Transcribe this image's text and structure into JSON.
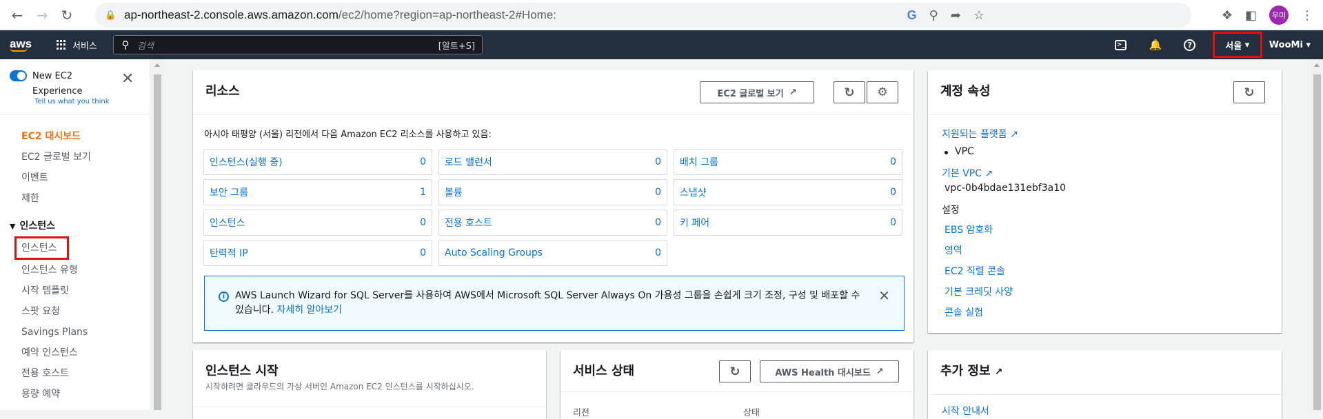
{
  "browser": {
    "url_host": "ap-northeast-2.console.aws.amazon.com",
    "url_path": "/ec2/home?region=ap-northeast-2#Home:",
    "avatar_text": "우미"
  },
  "aws_nav": {
    "logo": "aws",
    "services_label": "서비스",
    "search_placeholder": "검색",
    "search_shortcut": "[알트+S]",
    "region_label": "서울",
    "user_label": "WooMi"
  },
  "sidebar": {
    "toggle_label": "New EC2 Experience",
    "tell_us": "Tell us what you think",
    "top_items": [
      {
        "label": "EC2 대시보드",
        "active": true
      },
      {
        "label": "EC2 글로벌 보기"
      },
      {
        "label": "이벤트"
      },
      {
        "label": "제한"
      }
    ],
    "section_label": "인스턴스",
    "section_items": [
      {
        "label": "인스턴스",
        "highlighted": true
      },
      {
        "label": "인스턴스 유형"
      },
      {
        "label": "시작 템플릿"
      },
      {
        "label": "스팟 요청"
      },
      {
        "label": "Savings Plans"
      },
      {
        "label": "예약 인스턴스"
      },
      {
        "label": "전용 호스트"
      },
      {
        "label": "용량 예약"
      }
    ]
  },
  "resources": {
    "title": "리소스",
    "global_view_button": "EC2 글로벌 보기",
    "intro": "아시아 태평양 (서울) 리전에서 다음 Amazon EC2 리소스를 사용하고 있음:",
    "cells": [
      {
        "label": "인스턴스(실행 중)",
        "count": "0"
      },
      {
        "label": "로드 밸런서",
        "count": "0"
      },
      {
        "label": "배치 그룹",
        "count": "0"
      },
      {
        "label": "보안 그룹",
        "count": "1"
      },
      {
        "label": "볼륨",
        "count": "0"
      },
      {
        "label": "스냅샷",
        "count": "0"
      },
      {
        "label": "인스턴스",
        "count": "0"
      },
      {
        "label": "전용 호스트",
        "count": "0"
      },
      {
        "label": "키 페어",
        "count": "0"
      },
      {
        "label": "탄력적 IP",
        "count": "0"
      },
      {
        "label": "Auto Scaling Groups",
        "count": "0"
      }
    ],
    "alert_text": "AWS Launch Wizard for SQL Server를 사용하여 AWS에서 Microsoft SQL Server Always On 가용성 그룹을 손쉽게 크기 조정, 구성 및 배포할 수 있습니다.",
    "alert_link": "자세히 알아보기"
  },
  "account": {
    "title": "계정 속성",
    "supported_platforms": "지원되는 플랫폼",
    "vpc_bullet": "VPC",
    "default_vpc": "기본 VPC",
    "vpc_id": "vpc-0b4bdae131ebf3a10",
    "settings_label": "설정",
    "settings_links": [
      "EBS 암호화",
      "영역",
      "EC2 직렬 콘솔",
      "기본 크레딧 사양",
      "콘솔 실험"
    ]
  },
  "launch": {
    "title": "인스턴스 시작",
    "desc": "시작하려면 클라우드의 가상 서버인 Amazon EC2 인스턴스를 시작하십시오."
  },
  "service_health": {
    "title": "서비스 상태",
    "health_button": "AWS Health 대시보드",
    "col1": "리전",
    "col2": "상태"
  },
  "extra": {
    "title": "추가 정보",
    "first_link": "시작 안내서"
  }
}
